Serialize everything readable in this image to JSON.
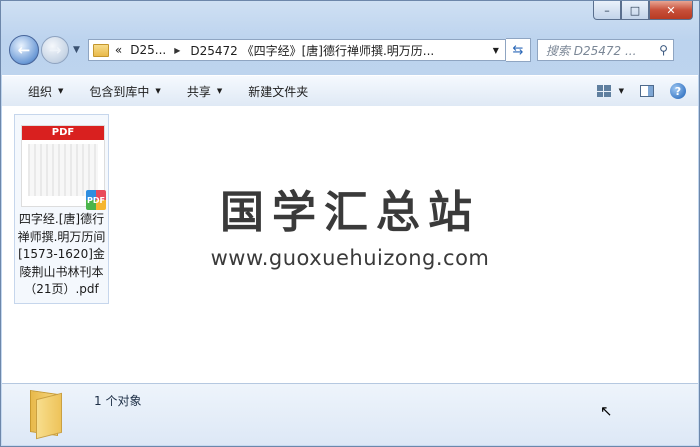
{
  "window": {
    "controls": {
      "minimize": "–",
      "maximize": "□",
      "close": "✕"
    }
  },
  "nav": {
    "back_glyph": "←",
    "forward_glyph": "→",
    "history_glyph": "▼",
    "breadcrumb_prefix": "«",
    "crumbs": [
      "D25...",
      "D25472 《四字经》[唐]德行禅师撰.明万历..."
    ],
    "search_placeholder": "搜索 D25472 ..."
  },
  "toolbar": {
    "organize": "组织",
    "include_in_library": "包含到库中",
    "share": "共享",
    "new_folder": "新建文件夹"
  },
  "file": {
    "thumb_label": "PDF",
    "badge": "PDF",
    "name": "四字经.[唐]德行禅师撰.明万历间[1573-1620]金陵荆山书林刊本（21页）.pdf"
  },
  "watermark": {
    "title": "国学汇总站",
    "url": "www.guoxuehuizong.com"
  },
  "status": {
    "count": "1 个对象"
  }
}
